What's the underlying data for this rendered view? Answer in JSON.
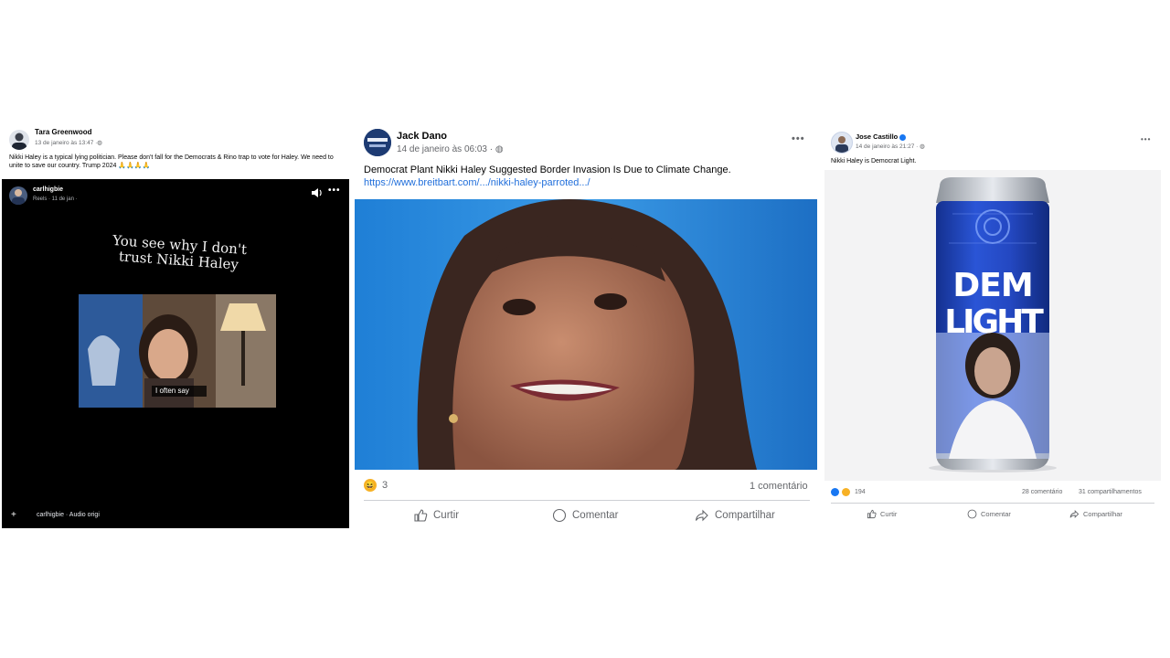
{
  "post1": {
    "author": "Tara Greenwood",
    "timestamp": "13 de janeiro às 13:47",
    "audience_icon": "globe-icon",
    "text": "Nikki Haley is a typical lying politician. Please don't fall for the Democrats & Rino trap to vote for Haley. We need to unite to save our country. Trump 2024 🙏🙏🙏🙏",
    "reel": {
      "author": "carlhigbie",
      "meta": "Reels · 11 de jan ·",
      "caption": "You see why I don't trust Nikki Haley",
      "subtitle": "I often say",
      "audio": "carlhigbie · Audio origi",
      "sound_icon": "speaker-icon"
    }
  },
  "post2": {
    "author": "Jack Dano",
    "timestamp": "14 de janeiro às 06:03 ·",
    "text": "Democrat Plant Nikki Haley Suggested Border Invasion Is Due to Climate Change.",
    "link": "https://www.breitbart.com/.../nikki-haley-parroted.../",
    "reaction_count": "3",
    "comments": "1 comentário",
    "actions": {
      "like": "Curtir",
      "comment": "Comentar",
      "share": "Compartilhar"
    }
  },
  "post3": {
    "author": "Jose Castillo",
    "timestamp": "14 de janeiro às 21:27 ·",
    "text": "Nikki Haley is Democrat Light.",
    "can_text_line1": "DEM",
    "can_text_line2": "LIGHT",
    "reaction_count": "194",
    "comments": "28 comentário",
    "shares": "31 compartilhamentos",
    "actions": {
      "like": "Curtir",
      "comment": "Comentar",
      "share": "Compartilhar"
    }
  },
  "colors": {
    "link": "#216fdb",
    "facebook_blue": "#1877f2",
    "can_blue": "#1f3fbf"
  }
}
